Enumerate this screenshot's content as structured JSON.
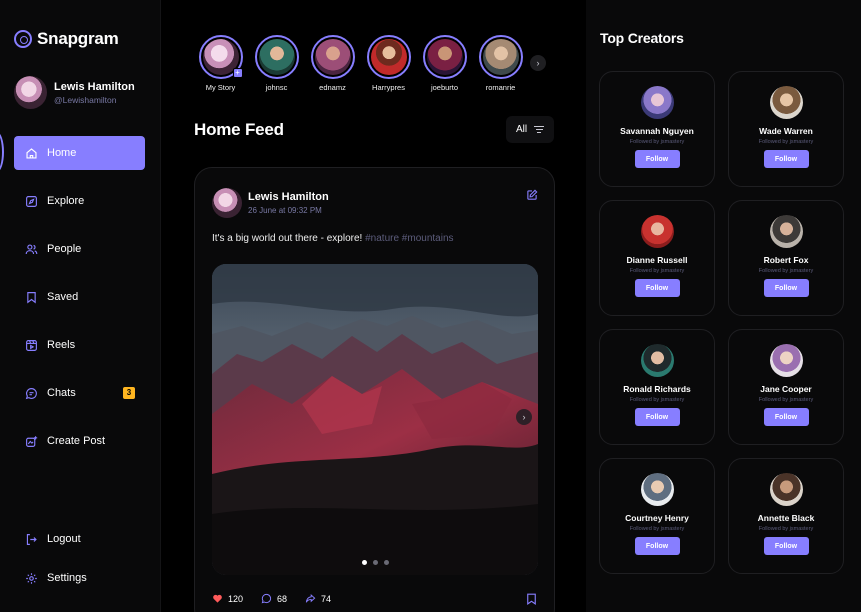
{
  "app": {
    "name": "Snapgram"
  },
  "user": {
    "name": "Lewis Hamilton",
    "handle": "@Lewishamilton"
  },
  "nav": {
    "items": [
      {
        "label": "Home",
        "icon": "home-icon",
        "active": true
      },
      {
        "label": "Explore",
        "icon": "explore-icon"
      },
      {
        "label": "People",
        "icon": "people-icon"
      },
      {
        "label": "Saved",
        "icon": "bookmark-icon"
      },
      {
        "label": "Reels",
        "icon": "reels-icon"
      },
      {
        "label": "Chats",
        "icon": "chat-icon",
        "badge": "3"
      },
      {
        "label": "Create Post",
        "icon": "create-post-icon"
      }
    ],
    "bottom": [
      {
        "label": "Logout",
        "icon": "logout-icon"
      },
      {
        "label": "Settings",
        "icon": "gear-icon"
      }
    ]
  },
  "stories": [
    {
      "label": "My Story"
    },
    {
      "label": "johnsc"
    },
    {
      "label": "ednamz"
    },
    {
      "label": "Harrypres"
    },
    {
      "label": "joeburto"
    },
    {
      "label": "romanrie"
    }
  ],
  "feed": {
    "title": "Home Feed",
    "filter_label": "All"
  },
  "post": {
    "author": "Lewis Hamilton",
    "date": "26 June at 09:32 PM",
    "caption": "It's a big world out there - explore!",
    "tags": "#nature #mountains",
    "likes": "120",
    "comments": "68",
    "shares": "74",
    "slides_total": 3,
    "slide_active": 1
  },
  "creators": {
    "title": "Top Creators",
    "follow_label": "Follow",
    "subtitle": "Followed by jsmastery",
    "items": [
      {
        "name": "Savannah Nguyen"
      },
      {
        "name": "Wade Warren"
      },
      {
        "name": "Dianne Russell"
      },
      {
        "name": "Robert Fox"
      },
      {
        "name": "Ronald Richards"
      },
      {
        "name": "Jane Cooper"
      },
      {
        "name": "Courtney Henry"
      },
      {
        "name": "Annette Black"
      }
    ]
  },
  "colors": {
    "accent": "#877eff",
    "badge": "#ffb620",
    "background": "#000000",
    "panel": "#09090a",
    "muted": "#7878a3",
    "like": "#ff5a5a"
  }
}
